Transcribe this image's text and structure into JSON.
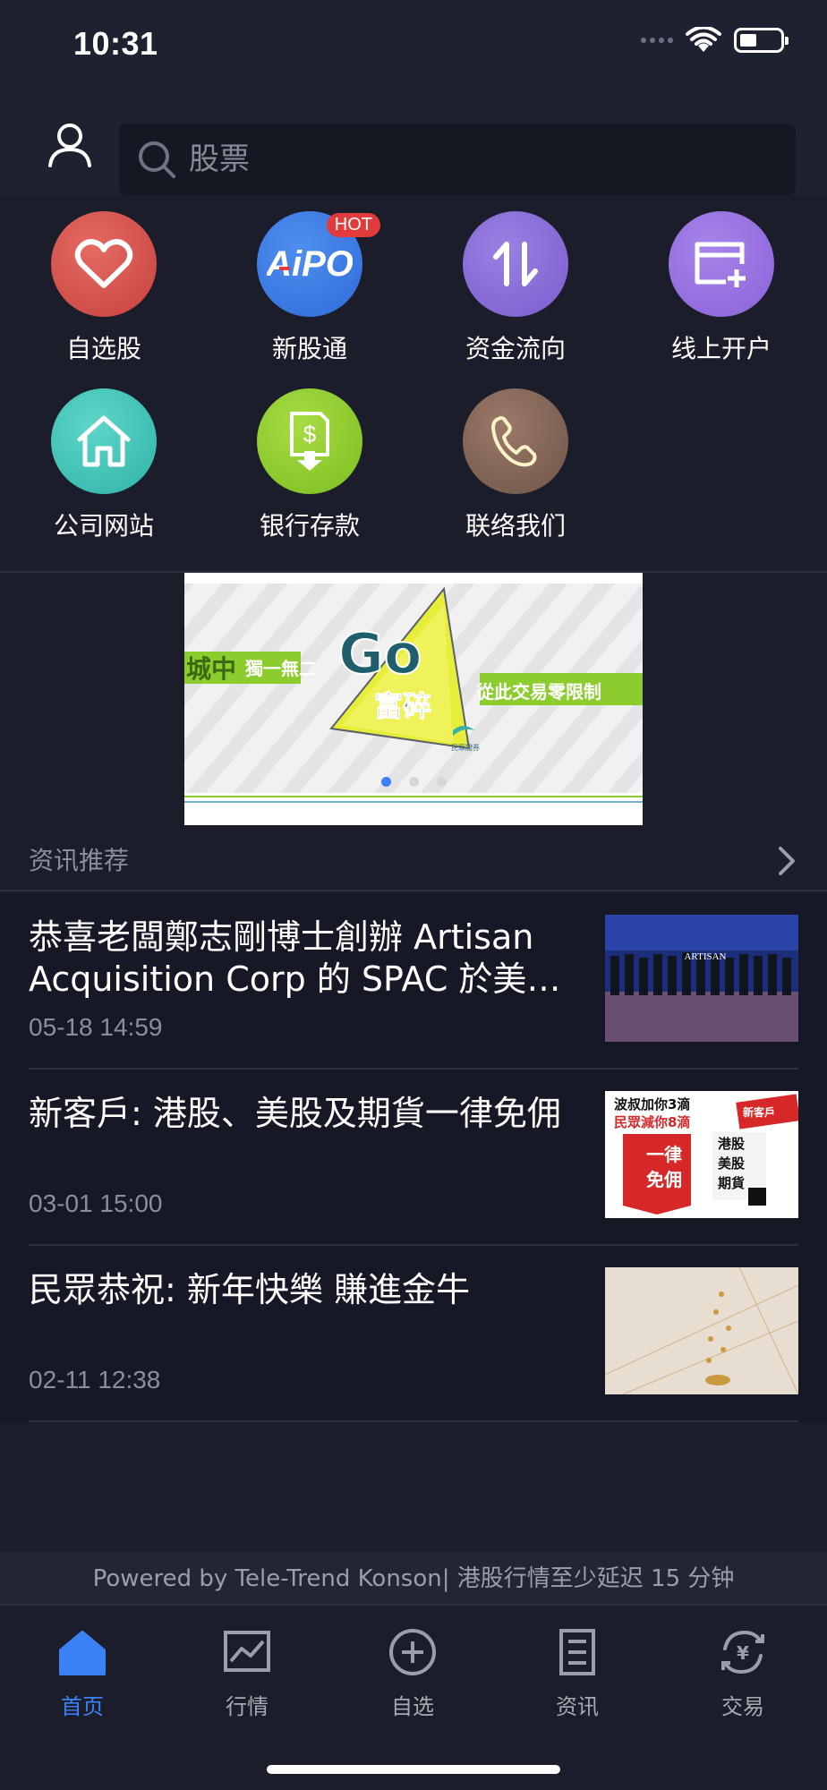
{
  "status_bar": {
    "time": "10:31"
  },
  "search": {
    "placeholder": "股票"
  },
  "menu": {
    "items": [
      {
        "label": "自选股",
        "icon": "heart-icon",
        "color": "#d9534f"
      },
      {
        "label": "新股通",
        "icon": "aipo-icon",
        "badge": "HOT",
        "color": "#3b82f6"
      },
      {
        "label": "资金流向",
        "icon": "flow-arrows-icon",
        "color": "#8b6fd6"
      },
      {
        "label": "线上开户",
        "icon": "open-account-icon",
        "color": "#9b72e0"
      },
      {
        "label": "公司网站",
        "icon": "house-icon",
        "color": "#3ec4b8"
      },
      {
        "label": "银行存款",
        "icon": "deposit-icon",
        "color": "#8ccc2e"
      },
      {
        "label": "联络我们",
        "icon": "phone-icon",
        "color": "#8a6a5a"
      }
    ]
  },
  "banner": {
    "left_text": "城中",
    "sub_text": "獨一無二",
    "go_text": "Go",
    "fu_text": "富碎",
    "right_text": "從此交易零限制",
    "logo_text": "民眾證券",
    "slides": 3,
    "active_slide": 1
  },
  "news": {
    "header": "资讯推荐",
    "items": [
      {
        "title": "恭喜老闆鄭志剛博士創辦 Artisan Acquisition Corp 的 SPAC 於美國上市",
        "time": "05-18 14:59",
        "thumb_text": "ARTISAN"
      },
      {
        "title": "新客戶: 港股、美股及期貨一律免佣",
        "time": "03-01 15:00",
        "thumb_text_1": "波叔加你3滴",
        "thumb_text_2": "民眾減你8滴",
        "thumb_tag": "新客戶",
        "thumb_side": "一律免佣",
        "thumb_list": "港股美股期貨"
      },
      {
        "title": "民眾恭祝: 新年快樂 賺進金牛",
        "time": "02-11 12:38"
      }
    ]
  },
  "footer": {
    "powered": "Powered by Tele-Trend Konson| 港股行情至少延迟 15 分钟"
  },
  "tabbar": {
    "items": [
      {
        "label": "首页",
        "icon": "home-icon",
        "active": true
      },
      {
        "label": "行情",
        "icon": "chart-icon",
        "active": false
      },
      {
        "label": "自选",
        "icon": "plus-circle-icon",
        "active": false
      },
      {
        "label": "资讯",
        "icon": "document-icon",
        "active": false
      },
      {
        "label": "交易",
        "icon": "yen-exchange-icon",
        "active": false
      }
    ]
  },
  "colors": {
    "accent": "#3b82f6",
    "background": "#1b1e2a",
    "hot": "#e23b3b"
  }
}
